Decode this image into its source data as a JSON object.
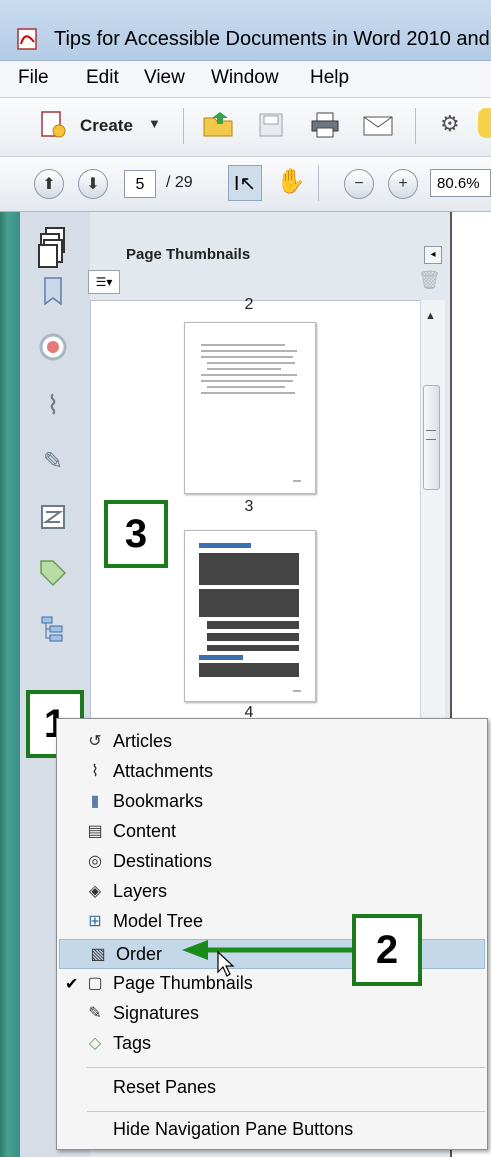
{
  "window": {
    "title": "Tips for Accessible Documents in Word 2010 and"
  },
  "menubar": {
    "items": [
      "File",
      "Edit",
      "View",
      "Window",
      "Help"
    ]
  },
  "toolbar": {
    "create_label": "Create",
    "page_current": "5",
    "page_total": "/ 29",
    "zoom": "80.6%"
  },
  "panel": {
    "title": "Page Thumbnails",
    "thumbnails": [
      {
        "label": "2"
      },
      {
        "label": "3"
      },
      {
        "label": "4"
      }
    ]
  },
  "callouts": [
    "1",
    "2",
    "3"
  ],
  "context_menu": {
    "items": [
      {
        "label": "Articles",
        "icon": "articles-icon",
        "glyph": "↺",
        "checked": false,
        "highlighted": false
      },
      {
        "label": "Attachments",
        "icon": "paperclip-icon",
        "glyph": "⌇",
        "checked": false,
        "highlighted": false
      },
      {
        "label": "Bookmarks",
        "icon": "bookmark-icon",
        "glyph": "▮",
        "checked": false,
        "highlighted": false
      },
      {
        "label": "Content",
        "icon": "content-icon",
        "glyph": "▤",
        "checked": false,
        "highlighted": false
      },
      {
        "label": "Destinations",
        "icon": "destinations-icon",
        "glyph": "◎",
        "checked": false,
        "highlighted": false
      },
      {
        "label": "Layers",
        "icon": "layers-icon",
        "glyph": "◈",
        "checked": false,
        "highlighted": false
      },
      {
        "label": "Model Tree",
        "icon": "model-tree-icon",
        "glyph": "⊞",
        "checked": false,
        "highlighted": false
      },
      {
        "label": "Order",
        "icon": "order-icon",
        "glyph": "▧",
        "checked": false,
        "highlighted": true
      },
      {
        "label": "Page Thumbnails",
        "icon": "page-thumbnails-icon",
        "glyph": "▢",
        "checked": true,
        "highlighted": false
      },
      {
        "label": "Signatures",
        "icon": "signatures-icon",
        "glyph": "✎",
        "checked": false,
        "highlighted": false
      },
      {
        "label": "Tags",
        "icon": "tags-icon",
        "glyph": "◇",
        "checked": false,
        "highlighted": false
      }
    ],
    "reset_label": "Reset Panes",
    "hide_label": "Hide Navigation Pane Buttons"
  },
  "colors": {
    "callout_border": "#1b7a1b",
    "highlight": "#c5d8ea",
    "arrow": "#1b8a1b"
  }
}
